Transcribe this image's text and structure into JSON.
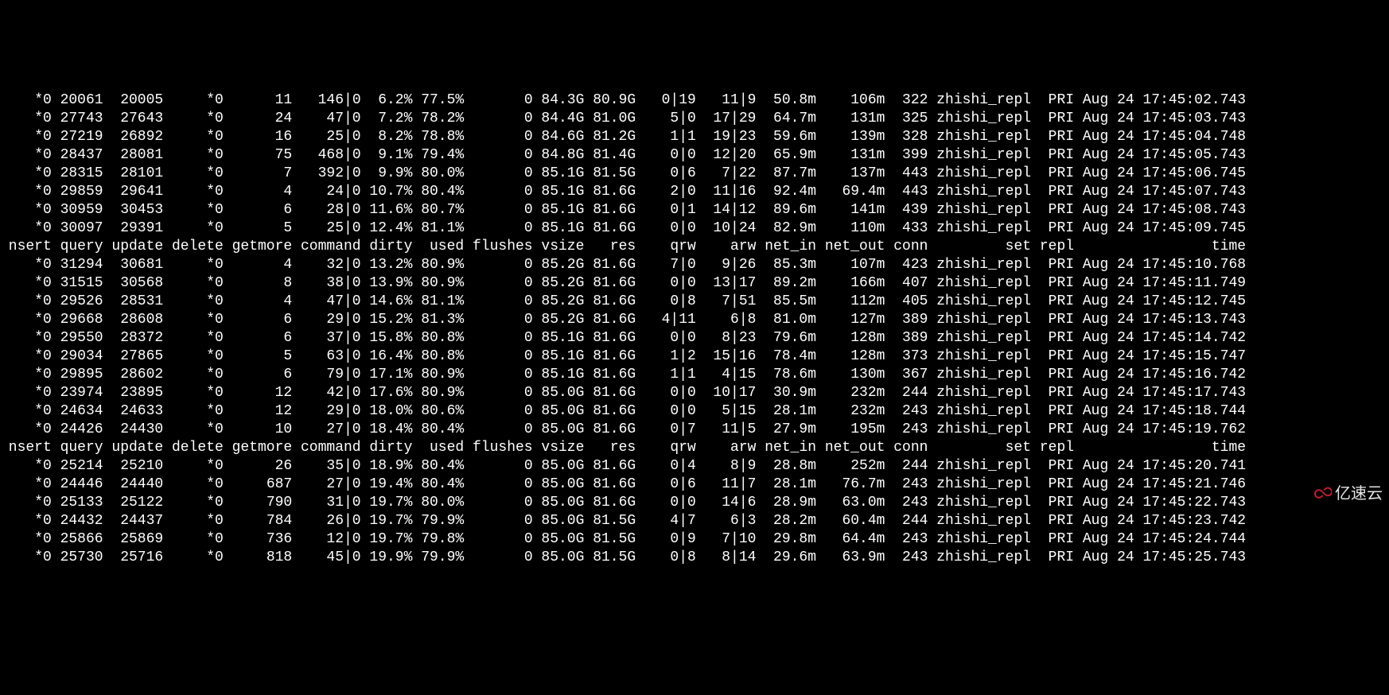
{
  "headers": [
    "nsert",
    "query",
    "update",
    "delete",
    "getmore",
    "command",
    "dirty",
    "used",
    "flushes",
    "vsize",
    "res",
    "qrw",
    "arw",
    "net_in",
    "net_out",
    "conn",
    "set",
    "repl",
    "time"
  ],
  "blocks": [
    {
      "rows": [
        [
          "*0",
          "20061",
          "20005",
          "*0",
          "11",
          "146|0",
          "6.2%",
          "77.5%",
          "0",
          "84.3G",
          "80.9G",
          "0|19",
          "11|9",
          "50.8m",
          "106m",
          "322",
          "zhishi_repl",
          "PRI",
          "Aug 24 17:45:02.743"
        ],
        [
          "*0",
          "27743",
          "27643",
          "*0",
          "24",
          "47|0",
          "7.2%",
          "78.2%",
          "0",
          "84.4G",
          "81.0G",
          "5|0",
          "17|29",
          "64.7m",
          "131m",
          "325",
          "zhishi_repl",
          "PRI",
          "Aug 24 17:45:03.743"
        ],
        [
          "*0",
          "27219",
          "26892",
          "*0",
          "16",
          "25|0",
          "8.2%",
          "78.8%",
          "0",
          "84.6G",
          "81.2G",
          "1|1",
          "19|23",
          "59.6m",
          "139m",
          "328",
          "zhishi_repl",
          "PRI",
          "Aug 24 17:45:04.748"
        ],
        [
          "*0",
          "28437",
          "28081",
          "*0",
          "75",
          "468|0",
          "9.1%",
          "79.4%",
          "0",
          "84.8G",
          "81.4G",
          "0|0",
          "12|20",
          "65.9m",
          "131m",
          "399",
          "zhishi_repl",
          "PRI",
          "Aug 24 17:45:05.743"
        ],
        [
          "*0",
          "28315",
          "28101",
          "*0",
          "7",
          "392|0",
          "9.9%",
          "80.0%",
          "0",
          "85.1G",
          "81.5G",
          "0|6",
          "7|22",
          "87.7m",
          "137m",
          "443",
          "zhishi_repl",
          "PRI",
          "Aug 24 17:45:06.745"
        ],
        [
          "*0",
          "29859",
          "29641",
          "*0",
          "4",
          "24|0",
          "10.7%",
          "80.4%",
          "0",
          "85.1G",
          "81.6G",
          "2|0",
          "11|16",
          "92.4m",
          "69.4m",
          "443",
          "zhishi_repl",
          "PRI",
          "Aug 24 17:45:07.743"
        ],
        [
          "*0",
          "30959",
          "30453",
          "*0",
          "6",
          "28|0",
          "11.6%",
          "80.7%",
          "0",
          "85.1G",
          "81.6G",
          "0|1",
          "14|12",
          "89.6m",
          "141m",
          "439",
          "zhishi_repl",
          "PRI",
          "Aug 24 17:45:08.743"
        ],
        [
          "*0",
          "30097",
          "29391",
          "*0",
          "5",
          "25|0",
          "12.4%",
          "81.1%",
          "0",
          "85.1G",
          "81.6G",
          "0|0",
          "10|24",
          "82.9m",
          "110m",
          "433",
          "zhishi_repl",
          "PRI",
          "Aug 24 17:45:09.745"
        ]
      ]
    },
    {
      "rows": [
        [
          "*0",
          "31294",
          "30681",
          "*0",
          "4",
          "32|0",
          "13.2%",
          "80.9%",
          "0",
          "85.2G",
          "81.6G",
          "7|0",
          "9|26",
          "85.3m",
          "107m",
          "423",
          "zhishi_repl",
          "PRI",
          "Aug 24 17:45:10.768"
        ],
        [
          "*0",
          "31515",
          "30568",
          "*0",
          "8",
          "38|0",
          "13.9%",
          "80.9%",
          "0",
          "85.2G",
          "81.6G",
          "0|0",
          "13|17",
          "89.2m",
          "166m",
          "407",
          "zhishi_repl",
          "PRI",
          "Aug 24 17:45:11.749"
        ],
        [
          "*0",
          "29526",
          "28531",
          "*0",
          "4",
          "47|0",
          "14.6%",
          "81.1%",
          "0",
          "85.2G",
          "81.6G",
          "0|8",
          "7|51",
          "85.5m",
          "112m",
          "405",
          "zhishi_repl",
          "PRI",
          "Aug 24 17:45:12.745"
        ],
        [
          "*0",
          "29668",
          "28608",
          "*0",
          "6",
          "29|0",
          "15.2%",
          "81.3%",
          "0",
          "85.2G",
          "81.6G",
          "4|11",
          "6|8",
          "81.0m",
          "127m",
          "389",
          "zhishi_repl",
          "PRI",
          "Aug 24 17:45:13.743"
        ],
        [
          "*0",
          "29550",
          "28372",
          "*0",
          "6",
          "37|0",
          "15.8%",
          "80.8%",
          "0",
          "85.1G",
          "81.6G",
          "0|0",
          "8|23",
          "79.6m",
          "128m",
          "389",
          "zhishi_repl",
          "PRI",
          "Aug 24 17:45:14.742"
        ],
        [
          "*0",
          "29034",
          "27865",
          "*0",
          "5",
          "63|0",
          "16.4%",
          "80.8%",
          "0",
          "85.1G",
          "81.6G",
          "1|2",
          "15|16",
          "78.4m",
          "128m",
          "373",
          "zhishi_repl",
          "PRI",
          "Aug 24 17:45:15.747"
        ],
        [
          "*0",
          "29895",
          "28602",
          "*0",
          "6",
          "79|0",
          "17.1%",
          "80.9%",
          "0",
          "85.1G",
          "81.6G",
          "1|1",
          "4|15",
          "78.6m",
          "130m",
          "367",
          "zhishi_repl",
          "PRI",
          "Aug 24 17:45:16.742"
        ],
        [
          "*0",
          "23974",
          "23895",
          "*0",
          "12",
          "42|0",
          "17.6%",
          "80.9%",
          "0",
          "85.0G",
          "81.6G",
          "0|0",
          "10|17",
          "30.9m",
          "232m",
          "244",
          "zhishi_repl",
          "PRI",
          "Aug 24 17:45:17.743"
        ],
        [
          "*0",
          "24634",
          "24633",
          "*0",
          "12",
          "29|0",
          "18.0%",
          "80.6%",
          "0",
          "85.0G",
          "81.6G",
          "0|0",
          "5|15",
          "28.1m",
          "232m",
          "243",
          "zhishi_repl",
          "PRI",
          "Aug 24 17:45:18.744"
        ],
        [
          "*0",
          "24426",
          "24430",
          "*0",
          "10",
          "27|0",
          "18.4%",
          "80.4%",
          "0",
          "85.0G",
          "81.6G",
          "0|7",
          "11|5",
          "27.9m",
          "195m",
          "243",
          "zhishi_repl",
          "PRI",
          "Aug 24 17:45:19.762"
        ]
      ]
    },
    {
      "rows": [
        [
          "*0",
          "25214",
          "25210",
          "*0",
          "26",
          "35|0",
          "18.9%",
          "80.4%",
          "0",
          "85.0G",
          "81.6G",
          "0|4",
          "8|9",
          "28.8m",
          "252m",
          "244",
          "zhishi_repl",
          "PRI",
          "Aug 24 17:45:20.741"
        ],
        [
          "*0",
          "24446",
          "24440",
          "*0",
          "687",
          "27|0",
          "19.4%",
          "80.4%",
          "0",
          "85.0G",
          "81.6G",
          "0|6",
          "11|7",
          "28.1m",
          "76.7m",
          "243",
          "zhishi_repl",
          "PRI",
          "Aug 24 17:45:21.746"
        ],
        [
          "*0",
          "25133",
          "25122",
          "*0",
          "790",
          "31|0",
          "19.7%",
          "80.0%",
          "0",
          "85.0G",
          "81.6G",
          "0|0",
          "14|6",
          "28.9m",
          "63.0m",
          "243",
          "zhishi_repl",
          "PRI",
          "Aug 24 17:45:22.743"
        ],
        [
          "*0",
          "24432",
          "24437",
          "*0",
          "784",
          "26|0",
          "19.7%",
          "79.9%",
          "0",
          "85.0G",
          "81.5G",
          "4|7",
          "6|3",
          "28.2m",
          "60.4m",
          "244",
          "zhishi_repl",
          "PRI",
          "Aug 24 17:45:23.742"
        ],
        [
          "*0",
          "25866",
          "25869",
          "*0",
          "736",
          "12|0",
          "19.7%",
          "79.8%",
          "0",
          "85.0G",
          "81.5G",
          "0|9",
          "7|10",
          "29.8m",
          "64.4m",
          "243",
          "zhishi_repl",
          "PRI",
          "Aug 24 17:45:24.744"
        ],
        [
          "*0",
          "25730",
          "25716",
          "*0",
          "818",
          "45|0",
          "19.9%",
          "79.9%",
          "0",
          "85.0G",
          "81.5G",
          "0|8",
          "8|14",
          "29.6m",
          "63.9m",
          "243",
          "zhishi_repl",
          "PRI",
          "Aug 24 17:45:25.743"
        ]
      ]
    }
  ],
  "watermark": "亿速云"
}
